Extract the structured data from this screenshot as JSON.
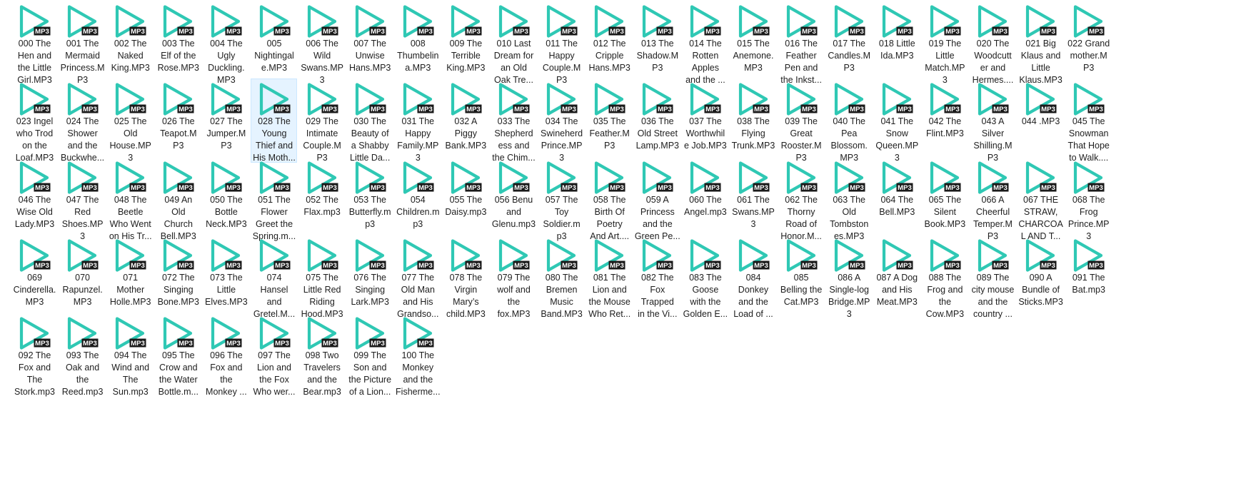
{
  "view": {
    "name": "file-explorer-large-icons",
    "selected_index": 28,
    "icon": {
      "name": "mp3-play-icon",
      "badge_text": "MP3",
      "play_color": "#2fc8b4",
      "badge_color": "#1a1a1a",
      "badge_text_color": "#ffffff"
    },
    "selection_colors": {
      "background": "#e5f3ff",
      "border": "#cce8ff"
    }
  },
  "files": [
    {
      "name": "000 The Hen and the Little Girl.MP3",
      "lines": [
        "000 The",
        "Hen and",
        "the Little",
        "Girl.MP3"
      ]
    },
    {
      "name": "001 The Mermaid Princess.MP3",
      "lines": [
        "001 The",
        "Mermaid",
        "Princess.M",
        "P3"
      ]
    },
    {
      "name": "002 The Naked King.MP3",
      "lines": [
        "002 The",
        "Naked",
        "King.MP3"
      ]
    },
    {
      "name": "003 The Elf of the Rose.MP3",
      "lines": [
        "003 The",
        "Elf of the",
        "Rose.MP3"
      ]
    },
    {
      "name": "004 The Ugly Duckling.MP3",
      "lines": [
        "004 The",
        "Ugly",
        "Duckling.",
        "MP3"
      ]
    },
    {
      "name": "005 Nightingale.MP3",
      "lines": [
        "005",
        "Nightingal",
        "e.MP3"
      ]
    },
    {
      "name": "006 The Wild Swans.MP3",
      "lines": [
        "006 The",
        "Wild",
        "Swans.MP",
        "3"
      ]
    },
    {
      "name": "007 The Unwise Hans.MP3",
      "lines": [
        "007 The",
        "Unwise",
        "Hans.MP3"
      ]
    },
    {
      "name": "008 Thumbelina.MP3",
      "lines": [
        "008",
        "Thumbelin",
        "a.MP3"
      ]
    },
    {
      "name": "009 The Terrible King.MP3",
      "lines": [
        "009 The",
        "Terrible",
        "King.MP3"
      ]
    },
    {
      "name": "010 Last Dream for an Old Oak Tree",
      "lines": [
        "010 Last",
        "Dream for",
        "an Old",
        "Oak Tre..."
      ]
    },
    {
      "name": "011 The Happy Couple.MP3",
      "lines": [
        "011 The",
        "Happy",
        "Couple.M",
        "P3"
      ]
    },
    {
      "name": "012 The Cripple Hans.MP3",
      "lines": [
        "012 The",
        "Cripple",
        "Hans.MP3"
      ]
    },
    {
      "name": "013 The Shadow.MP3",
      "lines": [
        "013 The",
        "Shadow.M",
        "P3"
      ]
    },
    {
      "name": "014 The Rotten Apples and the ...",
      "lines": [
        "014 The",
        "Rotten",
        "Apples",
        "and the ..."
      ]
    },
    {
      "name": "015 The Anemone.MP3",
      "lines": [
        "015 The",
        "Anemone.",
        "MP3"
      ]
    },
    {
      "name": "016 The Feather Pen and the Inkst...",
      "lines": [
        "016 The",
        "Feather",
        "Pen and",
        "the Inkst..."
      ]
    },
    {
      "name": "017 The Candles.MP3",
      "lines": [
        "017 The",
        "Candles.M",
        "P3"
      ]
    },
    {
      "name": "018 Little Ida.MP3",
      "lines": [
        "018 Little",
        "Ida.MP3"
      ]
    },
    {
      "name": "019 The Little Match.MP3",
      "lines": [
        "019 The",
        "Little",
        "Match.MP",
        "3"
      ]
    },
    {
      "name": "020 The Woodcutter and Hermes....",
      "lines": [
        "020 The",
        "Woodcutt",
        "er and",
        "Hermes...."
      ]
    },
    {
      "name": "021 Big Klaus and Little Klaus.MP3",
      "lines": [
        "021 Big",
        "Klaus and",
        "Little",
        "Klaus.MP3"
      ]
    },
    {
      "name": "022 Grandmother.MP3",
      "lines": [
        "022 Grand",
        "mother.M",
        "P3"
      ]
    },
    {
      "name": "023 Ingel who Trod on the Loaf.MP3",
      "lines": [
        "023 Ingel",
        "who Trod",
        "on the",
        "Loaf.MP3"
      ]
    },
    {
      "name": "024 The Shower and the Buckwhe...",
      "lines": [
        "024 The",
        "Shower",
        "and the",
        "Buckwhe..."
      ]
    },
    {
      "name": "025 The Old House.MP3",
      "lines": [
        "025 The",
        "Old",
        "House.MP",
        "3"
      ]
    },
    {
      "name": "026 The Teapot.MP3",
      "lines": [
        "026 The",
        "Teapot.M",
        "P3"
      ]
    },
    {
      "name": "027 The Jumper.MP3",
      "lines": [
        "027 The",
        "Jumper.M",
        "P3"
      ]
    },
    {
      "name": "028 The Young Thief and His Moth...",
      "lines": [
        "028 The",
        "Young",
        "Thief and",
        "His Moth..."
      ]
    },
    {
      "name": "029 The Intimate Couple.MP3",
      "lines": [
        "029 The",
        "Intimate",
        "Couple.M",
        "P3"
      ]
    },
    {
      "name": "030 The Beauty of a Shabby Little Da...",
      "lines": [
        "030 The",
        "Beauty of",
        "a Shabby",
        "Little Da..."
      ]
    },
    {
      "name": "031 The Happy Family.MP3",
      "lines": [
        "031 The",
        "Happy",
        "Family.MP",
        "3"
      ]
    },
    {
      "name": "032 A Piggy Bank.MP3",
      "lines": [
        "032 A",
        "Piggy",
        "Bank.MP3"
      ]
    },
    {
      "name": "033 The Shepherdess and the Chim...",
      "lines": [
        "033 The",
        "Shepherd",
        "ess and",
        "the Chim..."
      ]
    },
    {
      "name": "034 The Swineherd Prince.MP3",
      "lines": [
        "034 The",
        "Swineherd",
        "Prince.MP",
        "3"
      ]
    },
    {
      "name": "035 The Feather.MP3",
      "lines": [
        "035 The",
        "Feather.M",
        "P3"
      ]
    },
    {
      "name": "036 The Old Street Lamp.MP3",
      "lines": [
        "036 The",
        "Old Street",
        "Lamp.MP3"
      ]
    },
    {
      "name": "037 The Worthwhile Job.MP3",
      "lines": [
        "037 The",
        "Worthwhil",
        "e Job.MP3"
      ]
    },
    {
      "name": "038 The Flying Trunk.MP3",
      "lines": [
        "038 The",
        "Flying",
        "Trunk.MP3"
      ]
    },
    {
      "name": "039 The Great Rooster.MP3",
      "lines": [
        "039 The",
        "Great",
        "Rooster.M",
        "P3"
      ]
    },
    {
      "name": "040 The Pea Blossom.MP3",
      "lines": [
        "040 The",
        "Pea",
        "Blossom.",
        "MP3"
      ]
    },
    {
      "name": "041 The Snow Queen.MP3",
      "lines": [
        "041 The",
        "Snow",
        "Queen.MP",
        "3"
      ]
    },
    {
      "name": "042 The Flint.MP3",
      "lines": [
        "042 The",
        "Flint.MP3"
      ]
    },
    {
      "name": "043 A Silver Shilling.MP3",
      "lines": [
        "043 A",
        "Silver",
        "Shilling.M",
        "P3"
      ]
    },
    {
      "name": "044 .MP3",
      "lines": [
        "044 .MP3"
      ]
    },
    {
      "name": "045 The Snowman That Hope to Walk....",
      "lines": [
        "045 The",
        "Snowman",
        "That Hope",
        "to Walk...."
      ]
    },
    {
      "name": "046 The Wise Old Lady.MP3",
      "lines": [
        "046 The",
        "Wise Old",
        "Lady.MP3"
      ]
    },
    {
      "name": "047 The Red Shoes.MP3",
      "lines": [
        "047 The",
        "Red",
        "Shoes.MP",
        "3"
      ]
    },
    {
      "name": "048 The Beetle Who Went on His Tr...",
      "lines": [
        "048 The",
        "Beetle",
        "Who Went",
        "on His Tr..."
      ]
    },
    {
      "name": "049 An Old Church Bell.MP3",
      "lines": [
        "049 An",
        "Old",
        "Church",
        "Bell.MP3"
      ]
    },
    {
      "name": "050 The Bottle Neck.MP3",
      "lines": [
        "050 The",
        "Bottle",
        "Neck.MP3"
      ]
    },
    {
      "name": "051 The Flower Greet the Spring.m...",
      "lines": [
        "051 The",
        "Flower",
        "Greet the",
        "Spring.m..."
      ]
    },
    {
      "name": "052 The Flax.mp3",
      "lines": [
        "052 The",
        "Flax.mp3"
      ]
    },
    {
      "name": "053 The Butterfly.mp3",
      "lines": [
        "053 The",
        "Butterfly.m",
        "p3"
      ]
    },
    {
      "name": "054 Children.mp3",
      "lines": [
        "054",
        "Children.m",
        "p3"
      ]
    },
    {
      "name": "055 The Daisy.mp3",
      "lines": [
        "055 The",
        "Daisy.mp3"
      ]
    },
    {
      "name": "056 Benu and Glenu.mp3",
      "lines": [
        "056 Benu",
        "and",
        "Glenu.mp3"
      ]
    },
    {
      "name": "057 The Toy Soldier.mp3",
      "lines": [
        "057 The",
        "Toy",
        "Soldier.m",
        "p3"
      ]
    },
    {
      "name": "058 The Birth Of Poetry And Art....",
      "lines": [
        "058 The",
        "Birth Of",
        "Poetry",
        "And Art...."
      ]
    },
    {
      "name": "059 A Princess and the Green Pe...",
      "lines": [
        "059 A",
        "Princess",
        "and the",
        "Green Pe..."
      ]
    },
    {
      "name": "060 The Angel.mp3",
      "lines": [
        "060 The",
        "Angel.mp3"
      ]
    },
    {
      "name": "061 The Swans.MP3",
      "lines": [
        "061 The",
        "Swans.MP",
        "3"
      ]
    },
    {
      "name": "062 The Thorny Road of Honor.M...",
      "lines": [
        "062 The",
        "Thorny",
        "Road of",
        "Honor.M..."
      ]
    },
    {
      "name": "063 The Old Tombstones.MP3",
      "lines": [
        "063 The",
        "Old",
        "Tombston",
        "es.MP3"
      ]
    },
    {
      "name": "064 The Bell.MP3",
      "lines": [
        "064 The",
        "Bell.MP3"
      ]
    },
    {
      "name": "065 The Silent Book.MP3",
      "lines": [
        "065 The",
        "Silent",
        "Book.MP3"
      ]
    },
    {
      "name": "066 A Cheerful Temper.MP3",
      "lines": [
        "066 A",
        "Cheerful",
        "Temper.M",
        "P3"
      ]
    },
    {
      "name": "067 THE STRAW, CHARCOAL AND T...",
      "lines": [
        "067 THE",
        "STRAW,",
        "CHARCOA",
        "L AND T..."
      ]
    },
    {
      "name": "068 The Frog Prince.MP3",
      "lines": [
        "068 The",
        "Frog",
        "Prince.MP",
        "3"
      ]
    },
    {
      "name": "069 Cinderella.MP3",
      "lines": [
        "069",
        "Cinderella.",
        "MP3"
      ]
    },
    {
      "name": "070 Rapunzel.MP3",
      "lines": [
        "070",
        "Rapunzel.",
        "MP3"
      ]
    },
    {
      "name": "071 Mother Holle.MP3",
      "lines": [
        "071",
        "Mother",
        "Holle.MP3"
      ]
    },
    {
      "name": "072 The Singing Bone.MP3",
      "lines": [
        "072 The",
        "Singing",
        "Bone.MP3"
      ]
    },
    {
      "name": "073 The Little Elves.MP3",
      "lines": [
        "073 The",
        "Little",
        "Elves.MP3"
      ]
    },
    {
      "name": "074 Hansel and Gretel.M...",
      "lines": [
        "074",
        "Hansel",
        "and",
        "Gretel.M..."
      ]
    },
    {
      "name": "075 The Little Red Riding Hood.MP3",
      "lines": [
        "075 The",
        "Little Red",
        "Riding",
        "Hood.MP3"
      ]
    },
    {
      "name": "076 The Singing Lark.MP3",
      "lines": [
        "076 The",
        "Singing",
        "Lark.MP3"
      ]
    },
    {
      "name": "077 The Old Man and His Grandso...",
      "lines": [
        "077 The",
        "Old Man",
        "and His",
        "Grandso..."
      ]
    },
    {
      "name": "078 The Virgin Mary’s child.MP3",
      "lines": [
        "078 The",
        "Virgin",
        "Mary’s",
        "child.MP3"
      ]
    },
    {
      "name": "079 The wolf and the fox.MP3",
      "lines": [
        "079 The",
        "wolf and",
        "the",
        "fox.MP3"
      ]
    },
    {
      "name": "080 The Bremen Music Band.MP3",
      "lines": [
        "080 The",
        "Bremen",
        "Music",
        "Band.MP3"
      ]
    },
    {
      "name": "081 The Lion and the Mouse Who Ret...",
      "lines": [
        "081 The",
        "Lion and",
        "the Mouse",
        "Who Ret..."
      ]
    },
    {
      "name": "082 The Fox Trapped in the Vi...",
      "lines": [
        "082 The",
        "Fox",
        "Trapped",
        "in the Vi..."
      ]
    },
    {
      "name": "083 The Goose with the Golden E...",
      "lines": [
        "083 The",
        "Goose",
        "with the",
        "Golden E..."
      ]
    },
    {
      "name": "084 Donkey and the Load of ...",
      "lines": [
        "084",
        "Donkey",
        "and the",
        "Load of ..."
      ]
    },
    {
      "name": "085 Belling the Cat.MP3",
      "lines": [
        "085",
        "Belling the",
        "Cat.MP3"
      ]
    },
    {
      "name": "086 A Single-log Bridge.MP3",
      "lines": [
        "086 A",
        "Single-log",
        "Bridge.MP",
        "3"
      ]
    },
    {
      "name": "087 A Dog and His Meat.MP3",
      "lines": [
        "087 A Dog",
        "and His",
        "Meat.MP3"
      ]
    },
    {
      "name": "088 The Frog and the Cow.MP3",
      "lines": [
        "088 The",
        "Frog and",
        "the",
        "Cow.MP3"
      ]
    },
    {
      "name": "089 The city mouse and the country ...",
      "lines": [
        "089 The",
        "city mouse",
        "and the",
        "country ..."
      ]
    },
    {
      "name": "090 A Bundle of Sticks.MP3",
      "lines": [
        "090 A",
        "Bundle of",
        "Sticks.MP3"
      ]
    },
    {
      "name": "091 The Bat.mp3",
      "lines": [
        "091 The",
        "Bat.mp3"
      ]
    },
    {
      "name": "092 The Fox and The Stork.mp3",
      "lines": [
        "092 The",
        "Fox and",
        "The",
        "Stork.mp3"
      ]
    },
    {
      "name": "093 The Oak and the Reed.mp3",
      "lines": [
        "093 The",
        "Oak and",
        "the",
        "Reed.mp3"
      ]
    },
    {
      "name": "094 The Wind and The Sun.mp3",
      "lines": [
        "094 The",
        "Wind and",
        "The",
        "Sun.mp3"
      ]
    },
    {
      "name": "095 The Crow and the Water Bottle.m...",
      "lines": [
        "095 The",
        "Crow and",
        "the Water",
        "Bottle.m..."
      ]
    },
    {
      "name": "096 The Fox and the Monkey ...",
      "lines": [
        "096 The",
        "Fox and",
        "the",
        "Monkey ..."
      ]
    },
    {
      "name": "097 The Lion and the Fox Who wer...",
      "lines": [
        "097 The",
        "Lion and",
        "the Fox",
        "Who wer..."
      ]
    },
    {
      "name": "098 Two Travelers and the Bear.mp3",
      "lines": [
        "098 Two",
        "Travelers",
        "and the",
        "Bear.mp3"
      ]
    },
    {
      "name": "099 The Son and the Picture of a Lion...",
      "lines": [
        "099 The",
        "Son and",
        "the Picture",
        "of a Lion..."
      ]
    },
    {
      "name": "100 The Monkey and the Fisherme...",
      "lines": [
        "100 The",
        "Monkey",
        "and the",
        "Fisherme..."
      ]
    }
  ]
}
